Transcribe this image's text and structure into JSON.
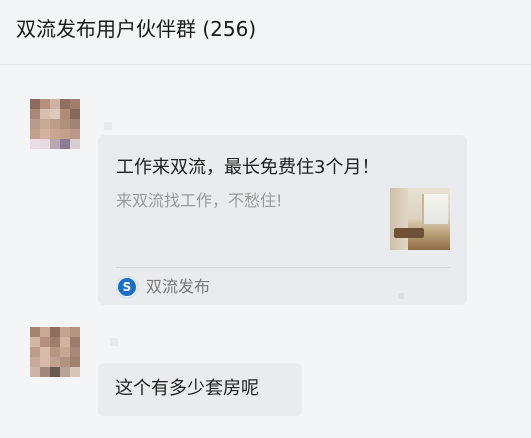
{
  "header": {
    "title": "双流发布用户伙伴群 (256)"
  },
  "messages": {
    "card": {
      "title": "工作来双流，最长免费住3个月！",
      "description": "来双流找工作，不愁住!",
      "source_logo_text": "S",
      "source_name": "双流发布"
    },
    "text": {
      "content": "这个有多少套房呢"
    }
  },
  "colors": {
    "background": "#f4f5f6",
    "bubble": "#e9ebee",
    "source_logo": "#1b6fc2"
  }
}
